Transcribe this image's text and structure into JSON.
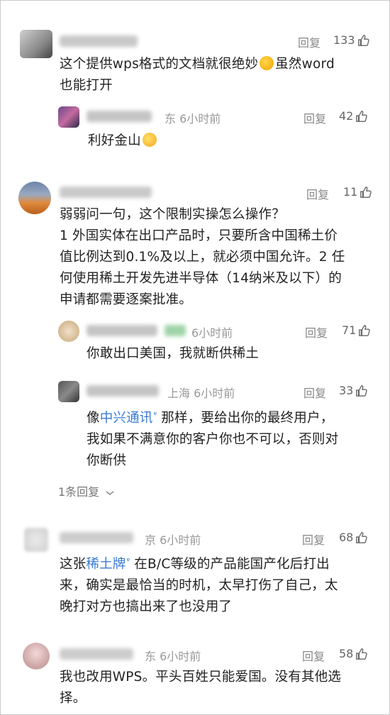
{
  "comments": [
    {
      "location": "",
      "time": "",
      "reply_label": "回复",
      "likes": "133",
      "text_line1": "这个提供wps格式的文档就很绝妙",
      "text_line1b": "虽然word",
      "text_line2": "也能打开"
    },
    {
      "location": "东",
      "time": "6小时前",
      "reply_label": "回复",
      "likes": "42",
      "text": "利好金山"
    },
    {
      "location": "",
      "time": "",
      "reply_label": "回复",
      "likes": "11",
      "lines": [
        "弱弱问一句，这个限制实操怎么操作？",
        "1  外国实体在出口产品时，只要所含中国稀土价",
        "值比例达到0.1%及以上，就必须中国允许。2  任",
        "何使用稀土开发先进半导体（14纳米及以下）的",
        "申请都需要逐案批准。"
      ]
    },
    {
      "location": "",
      "time": "6小时前",
      "reply_label": "回复",
      "likes": "71",
      "text": "你敢出口美国，我就断供稀土"
    },
    {
      "location": "上海",
      "time": "6小时前",
      "reply_label": "回复",
      "likes": "33",
      "prefix": "像",
      "link": "中兴通讯",
      "suffix": "那样，要给出你的最终用户，",
      "line2": "我如果不满意你的客户你也不可以，否则对",
      "line3": "你断供"
    },
    {
      "location": "京",
      "time": "6小时前",
      "reply_label": "回复",
      "likes": "68",
      "prefix": "这张",
      "link": "稀土牌",
      "suffix": "在B/C等级的产品能国产化后打出",
      "line2": "来，确实是最恰当的时机，太早打伤了自己，太",
      "line3": "晚打对方也搞出来了也没用了"
    },
    {
      "location": "东",
      "time": "6小时前",
      "reply_label": "回复",
      "likes": "58",
      "line1": "我也改用WPS。平头百姓只能爱国。没有其他选",
      "line2": "择。"
    }
  ],
  "more_replies": "1条回复",
  "search_glyph": "ᵠ",
  "colors": {
    "link": "#3a7bd5",
    "meta": "#999999"
  }
}
